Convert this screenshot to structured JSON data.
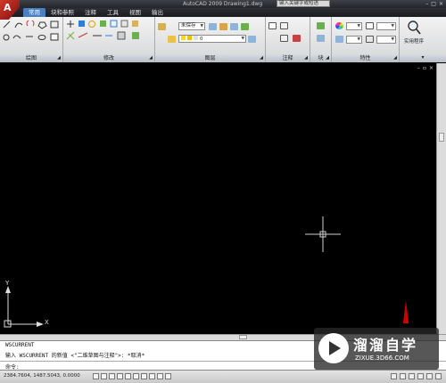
{
  "titlebar": {
    "logo_letter": "A",
    "doc_title": "AutoCAD 2009 Drawing1.dwg",
    "search_text": "键入关键字或短语",
    "window_controls": [
      "–",
      "□",
      "×"
    ]
  },
  "ribbon_tabs": [
    "常用",
    "块和参照",
    "注释",
    "工具",
    "视图",
    "输出"
  ],
  "ribbon": {
    "panels": [
      {
        "title": "绘图"
      },
      {
        "title": "修改"
      },
      {
        "title": "图层"
      },
      {
        "title": "注释"
      },
      {
        "title": "块"
      },
      {
        "title": "特性"
      }
    ],
    "layer_state_combo": "未保存",
    "layer_combo": "0",
    "utilities_label": "实用程序",
    "utilities_dropdown": "▾",
    "accent_color": "#4a7fc0"
  },
  "canvas": {
    "background": "#000000",
    "crosshair_color": "#cfcfcf",
    "ucs_x": "X",
    "ucs_y": "Y",
    "viewport_controls": [
      "–",
      "▫",
      "×"
    ]
  },
  "command_window": {
    "line1": "WSCURRENT",
    "line2": "输入 WSCURRENT 的新值 <\"二维草图与注释\">: *取消*",
    "prompt": "命令:"
  },
  "statusbar": {
    "coordinates": "2384.7604, 1487.5043, 0.0000"
  },
  "watermark": {
    "text": "溜溜自学",
    "sub": "ZIXUE.3D66.COM"
  }
}
